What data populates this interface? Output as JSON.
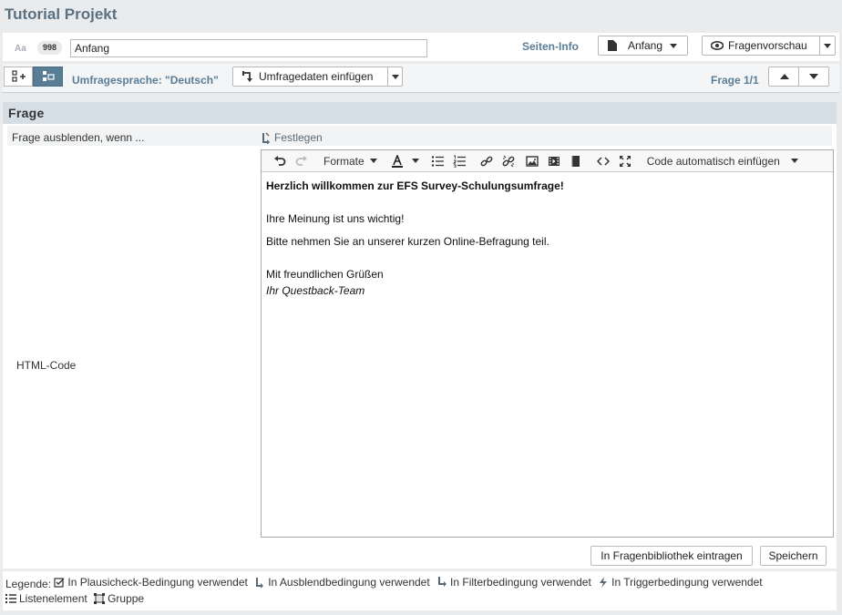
{
  "app": {
    "title": "Tutorial Projekt"
  },
  "page_bar": {
    "type_icon_label": "Aa",
    "page_id": "998",
    "page_name_value": "Anfang",
    "seiten_info_label": "Seiten-Info",
    "page_select_label": "Anfang",
    "preview_label": "Fragenvorschau"
  },
  "toolbar2": {
    "language_label": "Umfragesprache: \"Deutsch\"",
    "insert_data_label": "Umfragedaten einfügen",
    "question_counter": "Frage 1/1"
  },
  "section": {
    "title": "Frage"
  },
  "form": {
    "hide_label": "Frage ausblenden, wenn ...",
    "festlegen_label": "Festlegen",
    "html_code_label": "HTML-Code"
  },
  "editor": {
    "formats_label": "Formate",
    "auto_code_label": "Code automatisch einfügen",
    "content": {
      "heading": "Herzlich willkommen zur EFS Survey-Schulungsumfrage!",
      "line1": "Ihre Meinung ist uns wichtig!",
      "line2": "Bitte nehmen Sie an unserer kurzen Online-Befragung teil.",
      "line3": "Mit freundlichen Grüßen",
      "line4": "Ihr Questback-Team"
    }
  },
  "actions": {
    "library_label": "In Fragenbibliothek eintragen",
    "save_label": "Speichern"
  },
  "legend": {
    "prefix": "Legende:",
    "items": [
      {
        "icon": "plausicheck-icon",
        "label": "In Plausicheck-Bedingung verwendet"
      },
      {
        "icon": "hide-condition-icon",
        "label": "In Ausblendbedingung verwendet"
      },
      {
        "icon": "filter-icon",
        "label": "In Filterbedingung verwendet"
      },
      {
        "icon": "trigger-icon",
        "label": "In Triggerbedingung verwendet"
      },
      {
        "icon": "list-icon",
        "label": "Listenelement"
      },
      {
        "icon": "group-icon",
        "label": "Gruppe"
      }
    ]
  },
  "colors": {
    "accent": "#5a7d96",
    "section_bg": "#d5dde5",
    "page_bg": "#e9ebed"
  }
}
